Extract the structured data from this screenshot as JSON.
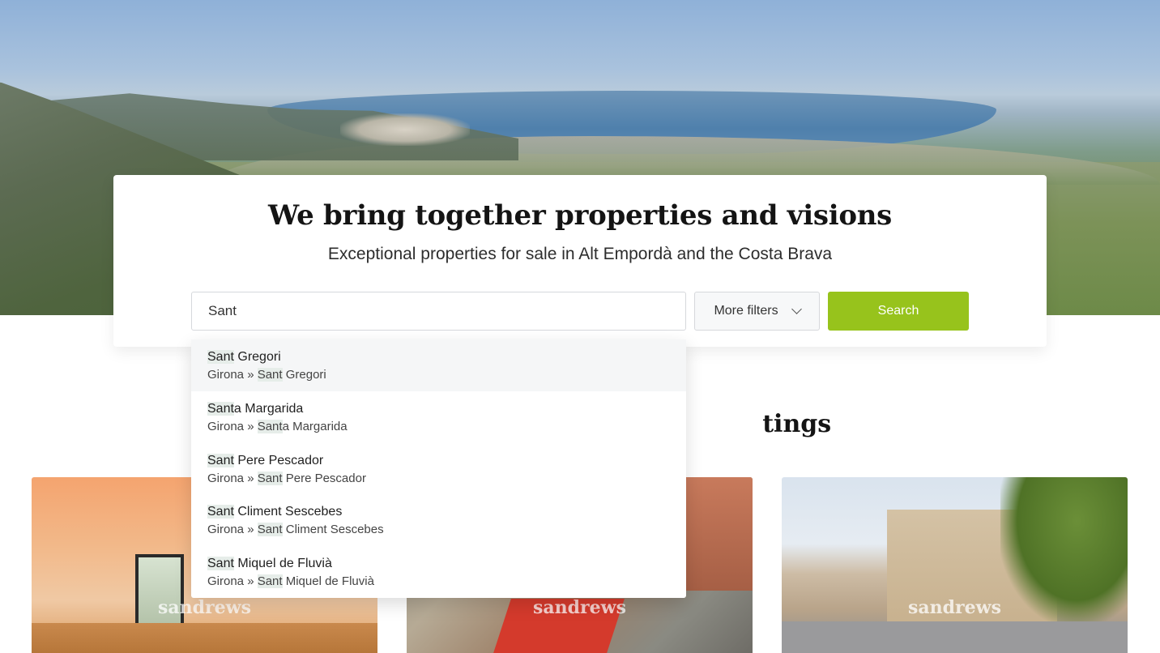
{
  "hero": {
    "title": "We bring together properties and visions",
    "subtitle": "Exceptional properties for sale in Alt Empordà and the Costa Brava"
  },
  "search": {
    "value": "Sant",
    "filters_label": "More filters",
    "search_label": "Search"
  },
  "listings": {
    "section_title": "...tings",
    "watermark": "sandrews"
  },
  "suggestions": [
    {
      "match": "Sant",
      "name_rest": " Gregori",
      "region": "Girona » ",
      "path_match": "Sant",
      "path_rest": " Gregori"
    },
    {
      "match": "Sant",
      "name_rest": "a Margarida",
      "region": "Girona » ",
      "path_match": "Sant",
      "path_rest": "a Margarida"
    },
    {
      "match": "Sant",
      "name_rest": " Pere Pescador",
      "region": "Girona » ",
      "path_match": "Sant",
      "path_rest": " Pere Pescador"
    },
    {
      "match": "Sant",
      "name_rest": " Climent Sescebes",
      "region": "Girona » ",
      "path_match": "Sant",
      "path_rest": " Climent Sescebes"
    },
    {
      "match": "Sant",
      "name_rest": " Miquel de Fluvià",
      "region": "Girona » ",
      "path_match": "Sant",
      "path_rest": " Miquel de Fluvià"
    }
  ],
  "colors": {
    "accent": "#97c31c",
    "highlight": "#e6ede9"
  }
}
